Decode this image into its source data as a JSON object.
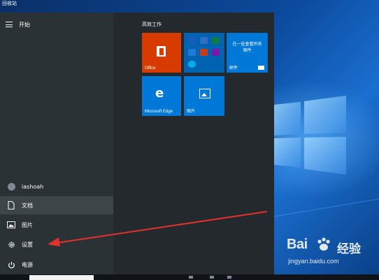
{
  "desktop": {
    "recycle_bin_label": "回收站"
  },
  "start_menu": {
    "header_label": "开始",
    "left_items": [
      {
        "label": "iashoah",
        "icon": "user-avatar-icon"
      },
      {
        "label": "文档",
        "icon": "document-icon"
      },
      {
        "label": "图片",
        "icon": "picture-icon"
      },
      {
        "label": "设置",
        "icon": "gear-icon"
      },
      {
        "label": "电源",
        "icon": "power-icon"
      }
    ],
    "tile_group_title": "高效工作",
    "tiles": {
      "office": "Office",
      "mail_text": "在一处查看所有\n邮件",
      "mail_label": "邮件",
      "edge": "Microsoft Edge",
      "edge_glyph": "e",
      "photos": "图片"
    }
  },
  "watermark": {
    "brand": "Bai",
    "jingyan": "经验",
    "url": "jingyan.baidu.com"
  },
  "colors": {
    "office_tile": "#d83b01",
    "tile_blue": "#0078d7",
    "annotation_arrow": "#e5302b"
  }
}
